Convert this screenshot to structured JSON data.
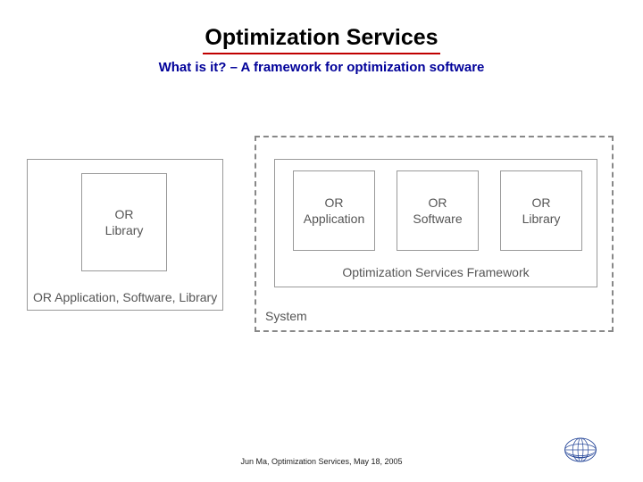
{
  "header": {
    "title": "Optimization Services",
    "subtitle": "What is it? – A framework for optimization software"
  },
  "diagram": {
    "left": {
      "inner": "OR\nLibrary",
      "outer_label": "OR Application, Software, Library"
    },
    "right": {
      "system_label": "System",
      "framework_label": "Optimization Services Framework",
      "boxes": {
        "b1": "OR\nApplication",
        "b2": "OR\nSoftware",
        "b3": "OR\nLibrary"
      }
    }
  },
  "footer": {
    "text": "Jun Ma, Optimization Services, May 18, 2005"
  }
}
